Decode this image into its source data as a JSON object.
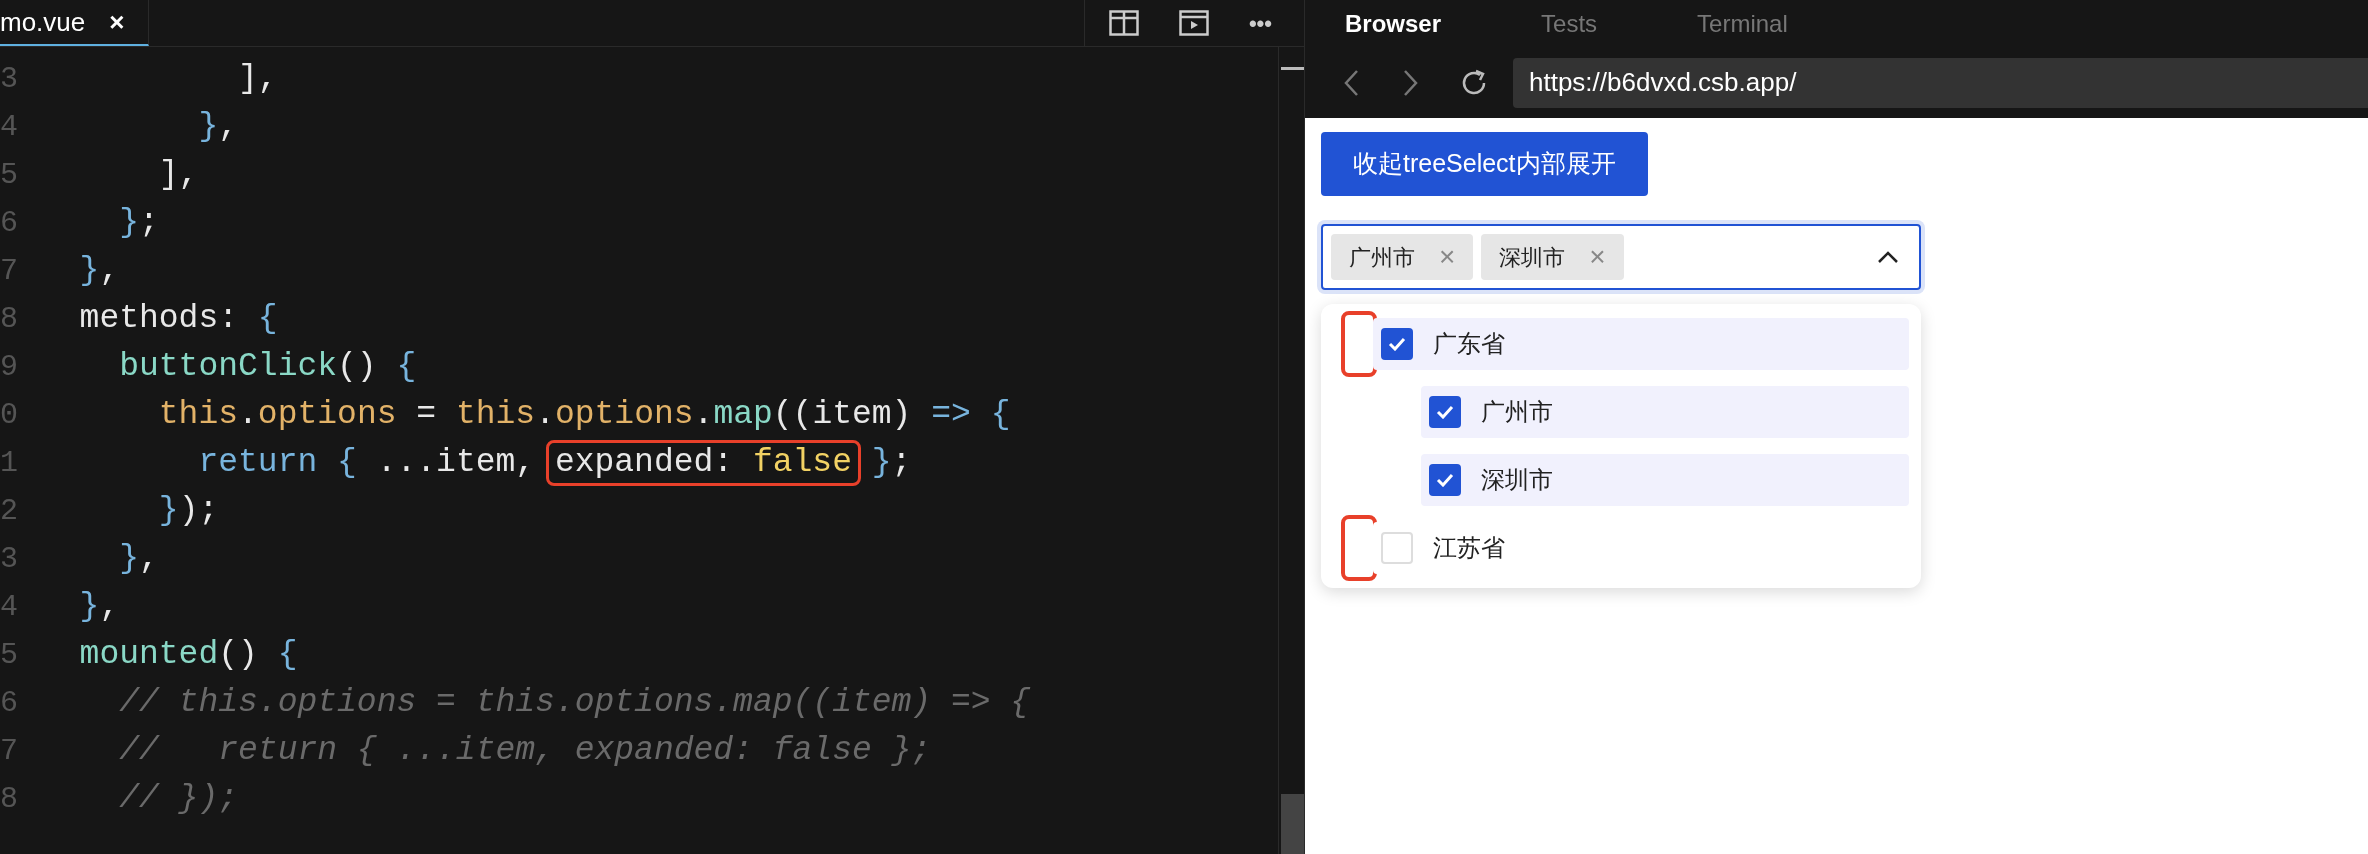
{
  "editor": {
    "tab": {
      "label": "mo.vue",
      "close": "×"
    },
    "toolbar_more": "•••",
    "lines": [
      {
        "number": "3",
        "tokens": [
          {
            "text": "          ],",
            "kind": "plain"
          }
        ]
      },
      {
        "number": "4",
        "tokens": [
          {
            "text": "        }",
            "kind": "brace"
          },
          {
            "text": ",",
            "kind": "plain"
          }
        ]
      },
      {
        "number": "5",
        "tokens": [
          {
            "text": "      ],",
            "kind": "plain"
          }
        ]
      },
      {
        "number": "6",
        "tokens": [
          {
            "text": "    }",
            "kind": "brace"
          },
          {
            "text": ";",
            "kind": "plain"
          }
        ]
      },
      {
        "number": "7",
        "tokens": [
          {
            "text": "  }",
            "kind": "brace"
          },
          {
            "text": ",",
            "kind": "plain"
          }
        ]
      },
      {
        "number": "8",
        "tokens": [
          {
            "text": "  methods: ",
            "kind": "plain"
          },
          {
            "text": "{",
            "kind": "brace"
          }
        ]
      },
      {
        "number": "9",
        "tokens": [
          {
            "text": "    buttonClick",
            "kind": "func"
          },
          {
            "text": "() ",
            "kind": "plain"
          },
          {
            "text": "{",
            "kind": "brace"
          }
        ]
      },
      {
        "number": "0",
        "tokens": [
          {
            "text": "      this",
            "kind": "prop"
          },
          {
            "text": ".",
            "kind": "plain"
          },
          {
            "text": "options",
            "kind": "prop"
          },
          {
            "text": " = ",
            "kind": "plain"
          },
          {
            "text": "this",
            "kind": "prop"
          },
          {
            "text": ".",
            "kind": "plain"
          },
          {
            "text": "options",
            "kind": "prop"
          },
          {
            "text": ".",
            "kind": "plain"
          },
          {
            "text": "map",
            "kind": "func"
          },
          {
            "text": "((item) ",
            "kind": "plain"
          },
          {
            "text": "=> {",
            "kind": "brace"
          }
        ]
      },
      {
        "number": "1",
        "tokens": [
          {
            "text": "        return {",
            "kind": "brace"
          },
          {
            "text": " ...item, ",
            "kind": "plain"
          },
          {
            "kind": "boxed",
            "tokens": [
              {
                "text": "expanded: ",
                "kind": "plain"
              },
              {
                "text": "false",
                "kind": "literal"
              }
            ]
          },
          {
            "text": " }",
            "kind": "brace"
          },
          {
            "text": ";",
            "kind": "plain"
          }
        ]
      },
      {
        "number": "2",
        "tokens": [
          {
            "text": "      }",
            "kind": "brace"
          },
          {
            "text": ");",
            "kind": "plain"
          }
        ]
      },
      {
        "number": "3",
        "tokens": [
          {
            "text": "    }",
            "kind": "brace"
          },
          {
            "text": ",",
            "kind": "plain"
          }
        ]
      },
      {
        "number": "4",
        "tokens": [
          {
            "text": "  }",
            "kind": "brace"
          },
          {
            "text": ",",
            "kind": "plain"
          }
        ]
      },
      {
        "number": "5",
        "tokens": [
          {
            "text": "  mounted",
            "kind": "func"
          },
          {
            "text": "() ",
            "kind": "plain"
          },
          {
            "text": "{",
            "kind": "brace"
          }
        ]
      },
      {
        "number": "6",
        "tokens": [
          {
            "text": "    // this.options = this.options.map((item) => {",
            "kind": "comment"
          }
        ]
      },
      {
        "number": "7",
        "tokens": [
          {
            "text": "    //   return { ...item, expanded: false };",
            "kind": "comment"
          }
        ]
      },
      {
        "number": "8",
        "tokens": [
          {
            "text": "    // });",
            "kind": "comment"
          }
        ]
      }
    ]
  },
  "preview": {
    "tabs": [
      {
        "label": "Browser",
        "selected": true
      },
      {
        "label": "Tests",
        "selected": false
      },
      {
        "label": "Terminal",
        "selected": false
      }
    ],
    "url": "https://b6dvxd.csb.app/",
    "button": "收起treeSelect内部展开",
    "select": {
      "open": true,
      "tags": [
        {
          "label": "广州市",
          "remove": "×"
        },
        {
          "label": "深圳市",
          "remove": "×"
        }
      ]
    },
    "tree": [
      {
        "label": "广东省",
        "checked": true,
        "annotated": true,
        "children": [
          {
            "label": "广州市",
            "checked": true,
            "annotated": false
          },
          {
            "label": "深圳市",
            "checked": true,
            "annotated": false
          }
        ]
      },
      {
        "label": "江苏省",
        "checked": false,
        "annotated": true
      }
    ]
  }
}
